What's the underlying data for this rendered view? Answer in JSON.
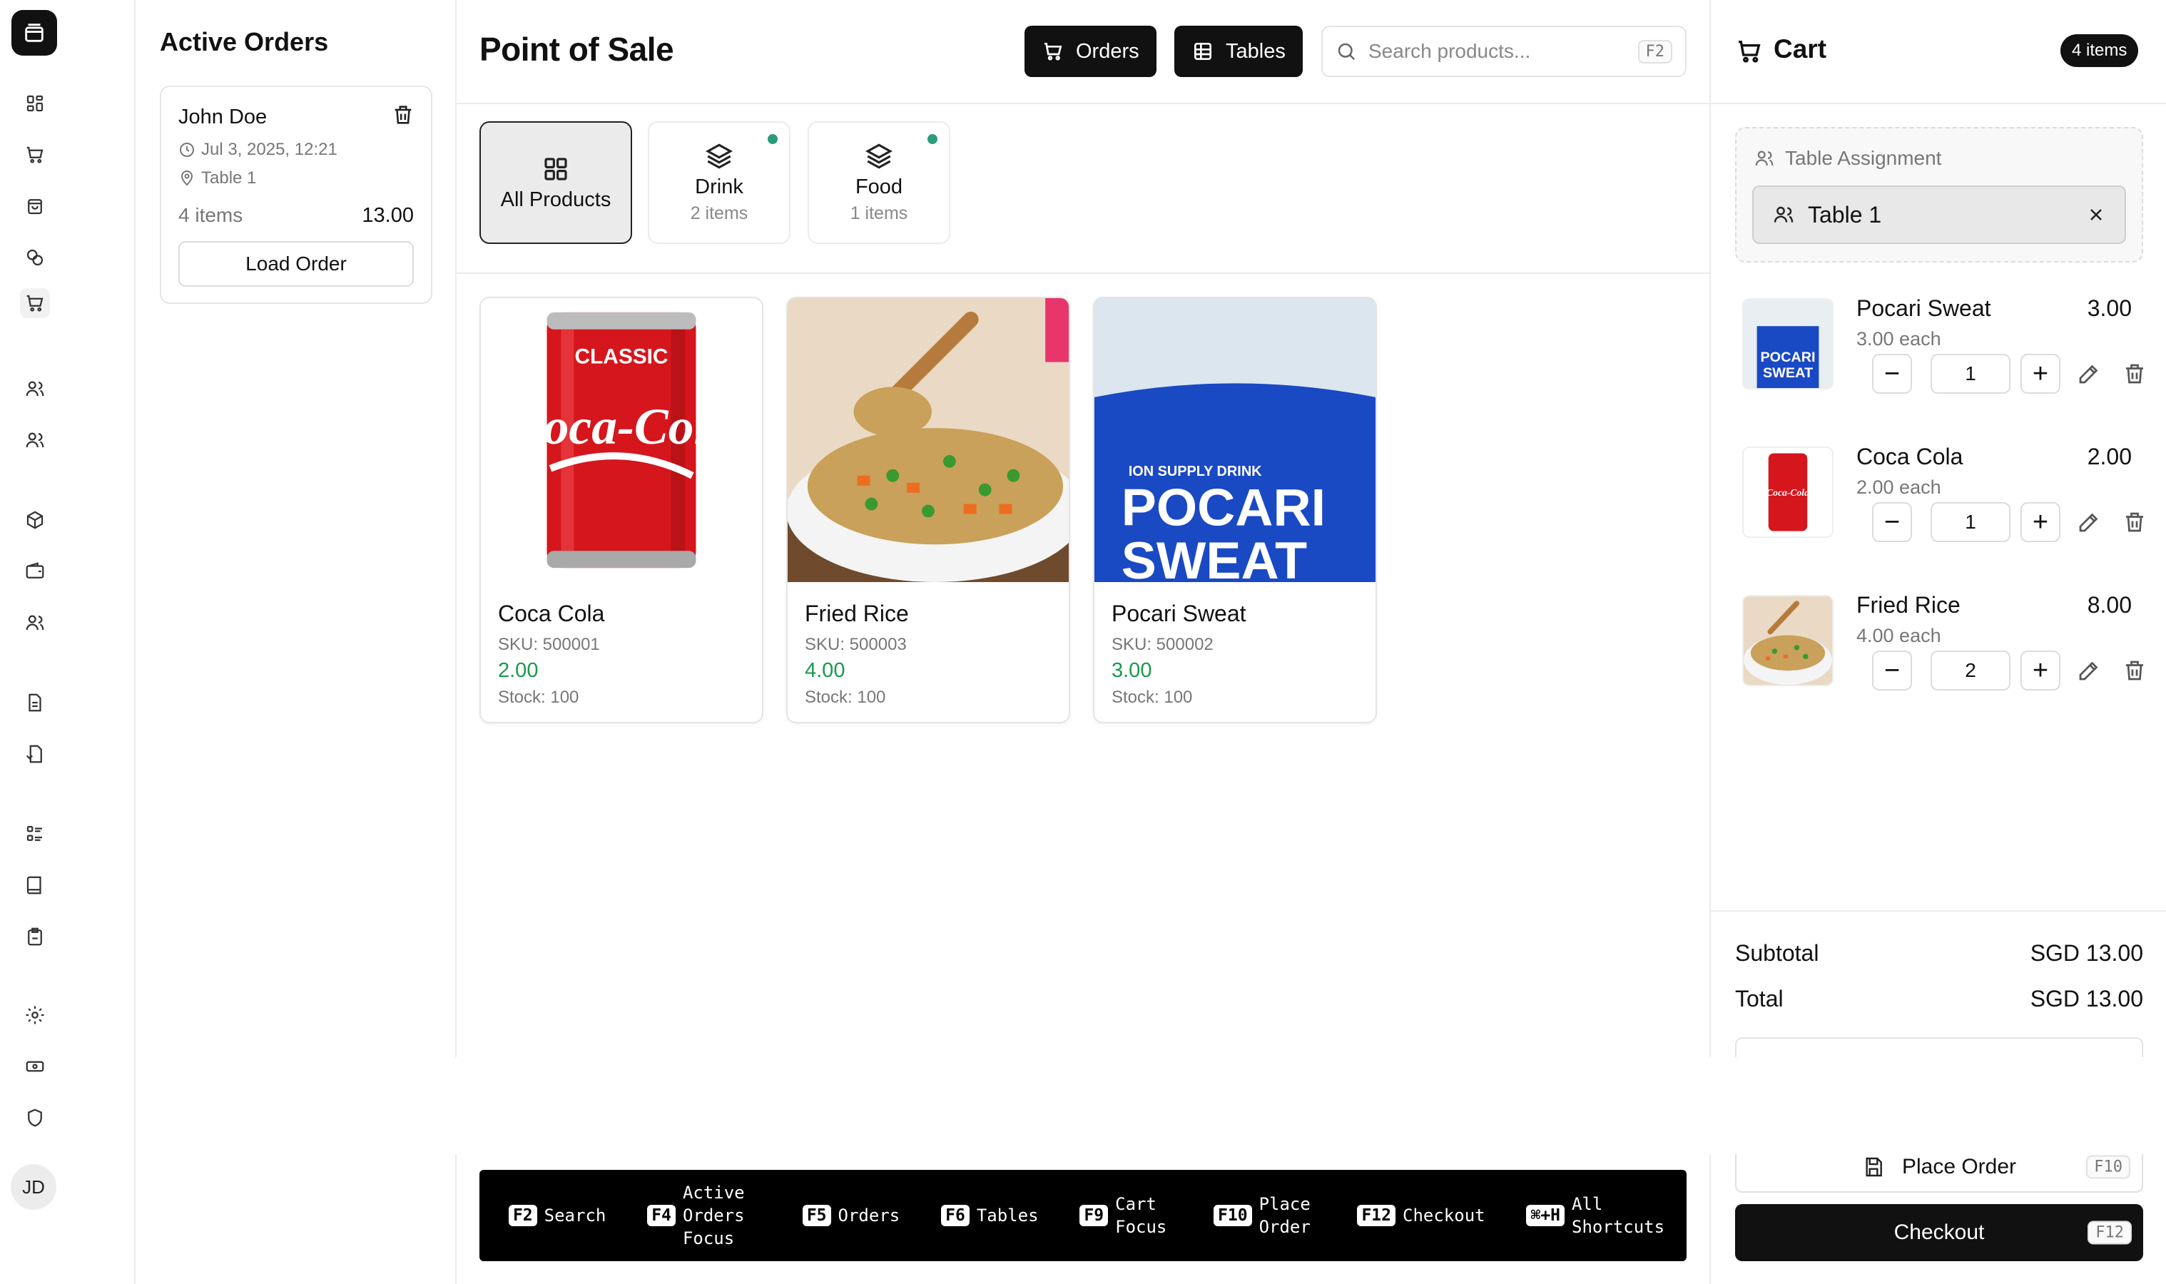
{
  "sidebar": {
    "icons": [
      "dashboard-icon",
      "cart-icon",
      "bag-icon",
      "coins-icon",
      "pos-cart-icon",
      "users-icon",
      "customers-icon",
      "box-icon",
      "wallet-icon",
      "staff-icon",
      "document-icon",
      "report-icon",
      "list-icon",
      "book-icon",
      "clipboard-icon",
      "settings-icon",
      "cash-icon",
      "shield-icon"
    ],
    "avatar_initials": "JD"
  },
  "active_orders": {
    "title": "Active Orders",
    "orders": [
      {
        "customer": "John Doe",
        "datetime": "Jul 3, 2025, 12:21",
        "table": "Table 1",
        "items": "4 items",
        "total": "13.00",
        "load_label": "Load Order"
      }
    ]
  },
  "header": {
    "title": "Point of Sale",
    "orders_label": "Orders",
    "tables_label": "Tables",
    "search_placeholder": "Search products...",
    "search_shortcut": "F2"
  },
  "categories": [
    {
      "name": "All Products",
      "count": "",
      "active": true
    },
    {
      "name": "Drink",
      "count": "2 items",
      "active": false
    },
    {
      "name": "Food",
      "count": "1 items",
      "active": false
    }
  ],
  "products": [
    {
      "name": "Coca Cola",
      "sku": "SKU: 500001",
      "price": "2.00",
      "stock": "Stock: 100",
      "image": "coca-cola-can"
    },
    {
      "name": "Fried Rice",
      "sku": "SKU: 500003",
      "price": "4.00",
      "stock": "Stock: 100",
      "image": "fried-rice-plate"
    },
    {
      "name": "Pocari Sweat",
      "sku": "SKU: 500002",
      "price": "3.00",
      "stock": "Stock: 100",
      "image": "pocari-sweat-bottle"
    }
  ],
  "image_text": {
    "coke_classic": "CLASSIC",
    "coke_script": "Coca-Cola",
    "pocari_top": "ION SUPPLY DRINK",
    "pocari_line1": "POCARI",
    "pocari_line2": "SWEAT"
  },
  "shortcuts": [
    {
      "key": "F2",
      "label": "Search"
    },
    {
      "key": "F4",
      "label": "Active Orders Focus"
    },
    {
      "key": "F5",
      "label": "Orders"
    },
    {
      "key": "F6",
      "label": "Tables"
    },
    {
      "key": "F9",
      "label": "Cart Focus"
    },
    {
      "key": "F10",
      "label": "Place Order"
    },
    {
      "key": "F12",
      "label": "Checkout"
    },
    {
      "key": "⌘+H",
      "label": "All Shortcuts"
    }
  ],
  "cart": {
    "title": "Cart",
    "count": "4 items",
    "table_assignment_label": "Table Assignment",
    "table_selected": "Table 1",
    "items": [
      {
        "name": "Pocari Sweat",
        "total": "3.00",
        "each": "3.00 each",
        "qty": "1"
      },
      {
        "name": "Coca Cola",
        "total": "2.00",
        "each": "2.00 each",
        "qty": "1"
      },
      {
        "name": "Fried Rice",
        "total": "8.00",
        "each": "4.00 each",
        "qty": "2"
      }
    ],
    "subtotal_label": "Subtotal",
    "subtotal_value": "SGD 13.00",
    "total_label": "Total",
    "total_value": "SGD 13.00",
    "place_order_label": "Place Order",
    "place_order_shortcut": "F10",
    "checkout_label": "Checkout",
    "checkout_shortcut": "F12"
  },
  "colors": {
    "accent_dark": "#111111",
    "price_green": "#1a9a4b",
    "status_dot": "#2a9d7c"
  }
}
